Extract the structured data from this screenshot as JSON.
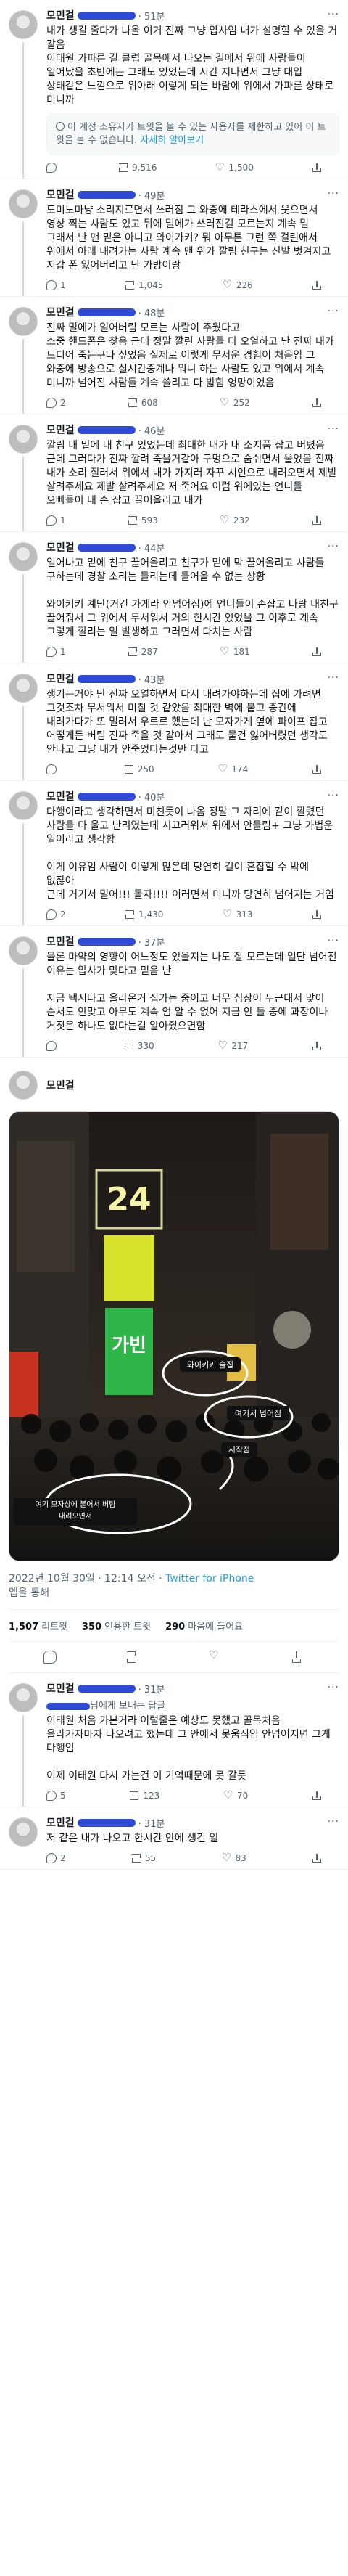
{
  "author": {
    "name": "모민걸"
  },
  "tweets": [
    {
      "time": "· 51분",
      "text": "내가 생길 줄다가 나올 이거 진짜 그냥 압사임 내가 설명할 수 있을 거 같음\n이태원 가파른 길 클럽 골목에서 나오는 길에서 위에 사람들이 일어났을 초반에는 그래도 있었는데 시간 지나면서 그냥 대입 상태같은 느낌으로 위아래 이렇게 되는 바람에 위에서 가파른 상태로 미니까",
      "notice": "이 계정 소유자가 트윗을 볼 수 있는 사용자를 제한하고 있어 이 트윗을 볼 수 없습니다.",
      "notice_link": "자세히 알아보기",
      "reply": "",
      "retweet": "9,516",
      "like": "1,500",
      "views": ""
    },
    {
      "time": "· 49분",
      "text": "도미노마냥 소리지르면서 쓰러짐 그 와중에 테라스에서 웃으면서 영상 찍는 사람도 있고 뒤에 밀에가 쓰러진걸 모르는지 계속 밀 그래서 난 맨 밑은 아니고 와이가키? 뭐 아무튼 그런 쪽 걸린애서 위에서 아래 내려가는 사람 계속 맨 위가 깔림 친구는 신발 벗겨지고 지갑 폰 잃어버리고 난 가방이랑",
      "reply": "1",
      "retweet": "1,045",
      "like": "226",
      "views": ""
    },
    {
      "time": "· 48분",
      "text": "진짜 밀에가 일어버림 모르는 사람이 주웠다고\n소중 핸드폰은 찾음 근데 정말 깔린 사람들 다 오열하고 난 진짜 내가 드디어 죽는구나 싶었음 실제로 이렇게 무서운 경험이 처음임 그 와중에 방송으로 실시간중계나 뭐니 하는 사람도 있고 위에서 계속 미니까 넘어진 사람들 계속 쓸리고 다 밟힘 엉망이었음",
      "reply": "2",
      "retweet": "608",
      "like": "252",
      "views": ""
    },
    {
      "time": "· 46분",
      "text": "깔림 내 밑에 내 친구 있었는데 최대한 내가 내 소지품 잡고 버텼음 근데 그러다가 진짜 깔려 죽을거같아 구멍으로 숨쉬면서 울었음 진짜 내가 소리 질러서 위에서 내가 가지러 자꾸 시인으로 내려오면서 제발 살려주세요 제발 살려주세요 저 죽어요 이럼 위에있는 언니들 오빠들이 내 손 잡고 끌어올리고 내가",
      "reply": "1",
      "retweet": "593",
      "like": "232",
      "views": ""
    },
    {
      "time": "· 44분",
      "text": "일어나고 밑에 친구 끌어올리고 친구가 밑에 막 끌어올리고 사람들 구하는데 경찰 소리는 들리는데 들어올 수 없는 상황\n\n와이키키 계단(거긴 가게라 안넘어짐)에 언니들이 손잡고 나랑 내친구 끌어줘서 그 위에서 무서워서 거의 한시간 있었을 그 이후로 계속 그렇게 깔리는 일 발생하고 그러면서 다치는 사람",
      "reply": "1",
      "retweet": "287",
      "like": "181",
      "views": ""
    },
    {
      "time": "· 43분",
      "text": "생기는거야 난 진짜 오열하면서 다시 내려가야하는데 집에 가려면 그것조차 무서워서 미칠 것 같았음 최대한 벽에 붙고 중간에 내려가다가 또 밀려서 우르르 했는데 난 모자가게 옆에 파이프 잡고 어떻게든 버팀 진짜 죽을 것 같아서 그래도 물건 잃어버렸던 생각도 안나고 그냥 내가 안죽었다는것만 다고",
      "reply": "",
      "retweet": "250",
      "like": "174",
      "views": ""
    },
    {
      "time": "· 40분",
      "text": "다행이라고 생각하면서 미친듯이 나옴 정말 그 자리에 같이 깔렸던 사람들 다 울고 난리였는데 시끄러워서 위에서 안들림+ 그냥 가볍운 일이라고 생각함\n\n이게 이유임 사람이 이렇게 많은데 당연히 길이 혼잡할 수 밖에 없잖아\n근데 거기서 밀어!!! 돌자!!!! 이러면서 미니까 당연히 넘어지는 거임",
      "reply": "2",
      "retweet": "1,430",
      "like": "313",
      "views": ""
    },
    {
      "time": "· 37분",
      "text": "물론 마약의 영향이 어느정도 있을지는 나도 잘 모르는데 일단 넘어진 이유는 압사가 맞다고 믿음 난\n\n지금 택시타고 올라온거 집가는 중이고 너무 심장이 두근대서 맞이 순서도 안맞고 아무도 계속 엄 알 수 없어 지금 안 들 중에 과장이나 거짓은 하나도 없다는걸 알아줬으면함",
      "reply": "",
      "retweet": "330",
      "like": "217",
      "views": ""
    }
  ],
  "main_tweet": {
    "photo_labels": {
      "sign24": "24",
      "sign_right": "가빈",
      "label_waikiki": "와이키키 술집",
      "label_fell": "여기서 넘어짐",
      "label_start": "시작점",
      "label_cap": "여기 모자상에 붙어서 버팀\n내려오면서"
    },
    "date": "2022년 10월 30일 · 12:14 오전 · ",
    "client": "Twitter for iPhone",
    "via": "앱을 통해",
    "stats": [
      {
        "num": "1,507",
        "label": "리트윗"
      },
      {
        "num": "350",
        "label": "인용한 트윗"
      },
      {
        "num": "290",
        "label": "마음에 들어요"
      }
    ]
  },
  "replies": [
    {
      "time": "· 31분",
      "reply_to": "님에게 보내는 답글",
      "text": "이태원 처음 가본거라 이럴줄은 예상도 못했고 골목처음 올라가자마자 나오려고 했는데 그 안에서 못움직임 안넘어지면 그게 다행임\n\n이제 이태원 다시 가는건 이 기억때문에 못 갈듯",
      "reply": "5",
      "retweet": "123",
      "like": "70",
      "views": ""
    },
    {
      "time": "· 31분",
      "text": "저 같은 내가 나오고 한시간 안에 생긴 일",
      "reply": "2",
      "retweet": "55",
      "like": "83",
      "views": ""
    }
  ]
}
